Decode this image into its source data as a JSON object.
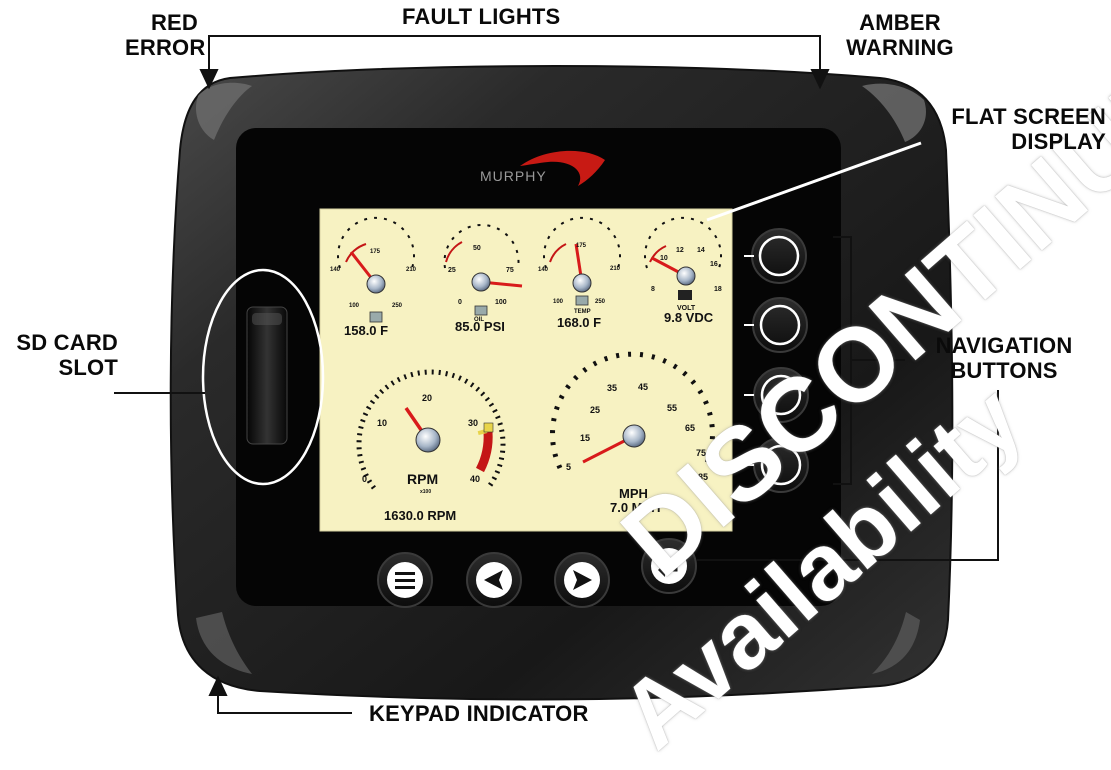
{
  "labels": {
    "fault_lights": "FAULT LIGHTS",
    "red_error": "RED\nERROR",
    "amber_warning": "AMBER\nWARNING",
    "flat_screen_display": "FLAT SCREEN\nDISPLAY",
    "sd_card_slot": "SD CARD\nSLOT",
    "navigation_buttons": "NAVIGATION\nBUTTONS",
    "keypad_indicator": "KEYPAD INDICATOR"
  },
  "brand": "MURPHY",
  "gauges": {
    "coolant": {
      "readout": "158.0 F",
      "ticks": [
        "140",
        "175",
        "210",
        "100",
        "250"
      ]
    },
    "oil_pressure": {
      "readout": "85.0 PSI",
      "ticks": [
        "25",
        "50",
        "75",
        "0",
        "100"
      ],
      "unit": "OIL"
    },
    "temp": {
      "readout": "168.0 F",
      "ticks": [
        "140",
        "175",
        "210",
        "100",
        "250"
      ],
      "unit": "TEMP"
    },
    "volt": {
      "readout": "9.8 VDC",
      "ticks": [
        "8",
        "10",
        "12",
        "14",
        "16",
        "18"
      ],
      "unit": "VOLT"
    },
    "rpm": {
      "readout": "1630.0 RPM",
      "label": "RPM",
      "ticks": [
        "0",
        "10",
        "20",
        "30",
        "40"
      ],
      "multiplier": "x100",
      "value": 16.3
    },
    "mph": {
      "readout": "7.0 MPH",
      "label": "MPH",
      "ticks": [
        "5",
        "15",
        "25",
        "35",
        "45",
        "55",
        "65",
        "75",
        "85"
      ],
      "value": 7.0
    }
  },
  "watermark": {
    "line1": "DISCONTINUED",
    "line2": "Availability"
  },
  "colors": {
    "screen": "#f7f2c2",
    "needle": "#d81b1b",
    "redline": "#c41616",
    "bezel": "#1d1d1d"
  }
}
